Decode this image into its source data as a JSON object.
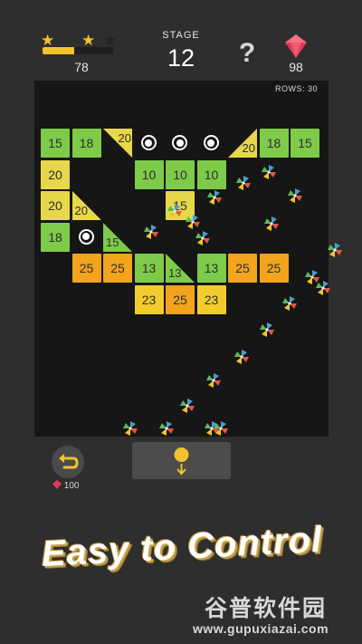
{
  "hud": {
    "stars": [
      {
        "state": "earned",
        "color": "#f2c32c"
      },
      {
        "state": "earned",
        "color": "#f2c32c"
      },
      {
        "state": "empty",
        "color": "#222222"
      }
    ],
    "progress_fraction": 0.45,
    "score": "78",
    "stage_label": "STAGE",
    "stage_number": "12",
    "help_icon": "question-mark-icon",
    "gem_icon": "red-gem-icon",
    "gems": "98"
  },
  "board": {
    "rows_label": "ROWS: 30",
    "colors": {
      "green": "#7ecb4a",
      "yellow": "#e6d84a",
      "orange": "#f2a41c",
      "gold": "#f2cc2c"
    },
    "bricks": [
      {
        "row": 0,
        "col": 0,
        "value": "15",
        "color": "green"
      },
      {
        "row": 0,
        "col": 1,
        "value": "18",
        "color": "green"
      },
      {
        "row": 0,
        "col": 7,
        "value": "18",
        "color": "green"
      },
      {
        "row": 0,
        "col": 8,
        "value": "15",
        "color": "green"
      },
      {
        "row": 1,
        "col": 0,
        "value": "20",
        "color": "yellow"
      },
      {
        "row": 1,
        "col": 3,
        "value": "10",
        "color": "green"
      },
      {
        "row": 1,
        "col": 4,
        "value": "10",
        "color": "green"
      },
      {
        "row": 1,
        "col": 5,
        "value": "10",
        "color": "green"
      },
      {
        "row": 2,
        "col": 0,
        "value": "20",
        "color": "yellow"
      },
      {
        "row": 2,
        "col": 4,
        "value": "15",
        "color": "yellow"
      },
      {
        "row": 3,
        "col": 0,
        "value": "18",
        "color": "green"
      },
      {
        "row": 4,
        "col": 1,
        "value": "25",
        "color": "orange"
      },
      {
        "row": 4,
        "col": 2,
        "value": "25",
        "color": "orange"
      },
      {
        "row": 4,
        "col": 3,
        "value": "13",
        "color": "green"
      },
      {
        "row": 4,
        "col": 5,
        "value": "13",
        "color": "green"
      },
      {
        "row": 4,
        "col": 6,
        "value": "25",
        "color": "orange"
      },
      {
        "row": 4,
        "col": 7,
        "value": "25",
        "color": "orange"
      },
      {
        "row": 5,
        "col": 3,
        "value": "23",
        "color": "gold"
      },
      {
        "row": 5,
        "col": 4,
        "value": "25",
        "color": "orange"
      },
      {
        "row": 5,
        "col": 5,
        "value": "23",
        "color": "gold"
      }
    ],
    "triangles": [
      {
        "row": 0,
        "col": 2,
        "value": "20",
        "color": "yellow",
        "corner": "tr"
      },
      {
        "row": 0,
        "col": 6,
        "value": "20",
        "color": "yellow",
        "corner": "br"
      },
      {
        "row": 2,
        "col": 1,
        "value": "20",
        "color": "yellow",
        "corner": "bl"
      },
      {
        "row": 3,
        "col": 2,
        "value": "15",
        "color": "green",
        "corner": "bl"
      },
      {
        "row": 4,
        "col": 4,
        "value": "13",
        "color": "green",
        "corner": "bl"
      }
    ],
    "rings": [
      {
        "row": 0,
        "col": 3
      },
      {
        "row": 0,
        "col": 4
      },
      {
        "row": 0,
        "col": 5
      },
      {
        "row": 3,
        "col": 1
      }
    ],
    "ball_icon": "pinwheel-ball-icon"
  },
  "controls": {
    "undo_icon": "undo-arrow-icon",
    "undo_cost": "100",
    "drop_icon": "drop-down-ball-icon"
  },
  "promo_text": "Easy to Control",
  "watermark": {
    "line1": "谷普软件园",
    "line2": "www.gupuxiazai.com"
  }
}
